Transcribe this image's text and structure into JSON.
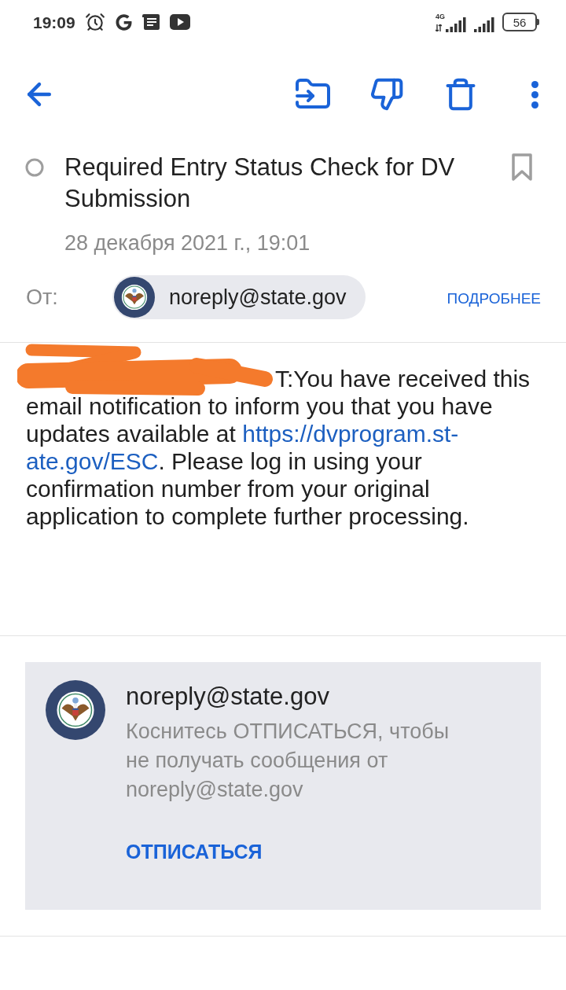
{
  "status_bar": {
    "time": "19:09",
    "network": "4G",
    "battery": "56"
  },
  "message": {
    "subject": "Required Entry Status Check for DV Submission",
    "bookmarked": false,
    "date": "28 декабря 2021 г., 19:01",
    "from_label": "От:",
    "sender": "noreply@state.gov",
    "details_link": "ПОДРОБНЕЕ"
  },
  "body": {
    "redacted": true,
    "parts": [
      {
        "kind": "text",
        "text": "T:You have received this email notification to inform you that you have updates available at "
      },
      {
        "kind": "link",
        "text": "https://dvprogram.st-"
      },
      {
        "kind": "link",
        "text": "ate.gov/ESC"
      },
      {
        "kind": "text",
        "text": ". Please log in using your confirmation number from your original application to complete further processing."
      }
    ]
  },
  "unsubscribe_card": {
    "sender": "noreply@state.gov",
    "note": "Коснитесь ОТПИСАТЬСЯ, чтобы не получать сообщения от noreply@state.gov",
    "button": "ОТПИСАТЬСЯ"
  }
}
